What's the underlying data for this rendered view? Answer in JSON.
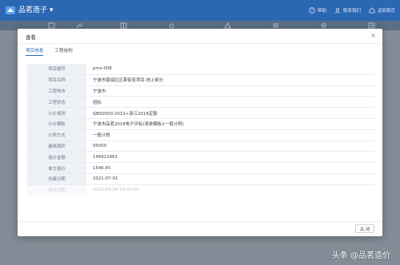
{
  "app": {
    "title": "品茗造子 ▾"
  },
  "top_actions": [
    {
      "label": "帮助",
      "icon": "help-icon"
    },
    {
      "label": "联系我们",
      "icon": "contact-icon"
    },
    {
      "label": "返回首页",
      "icon": "home-icon"
    }
  ],
  "modal": {
    "title": "查看",
    "tabs": [
      {
        "label": "项目信息",
        "active": true
      },
      {
        "label": "工程结构",
        "active": false
      }
    ],
    "rows": [
      {
        "key": "项目编号",
        "value": "pms-008"
      },
      {
        "key": "项目名称",
        "value": "宁波市镇海区区某街景项目-地上部分"
      },
      {
        "key": "工程地市",
        "value": "宁波市"
      },
      {
        "key": "工程状态",
        "value": "招标"
      },
      {
        "key": "计价规则",
        "value": "GB50500-2013+浙江2018定额"
      },
      {
        "key": "计价模板",
        "value": "宁波市品茗2018电子评标(清单模板)(一般计税)"
      },
      {
        "key": "计税方式",
        "value": "一般计税"
      },
      {
        "key": "建筑面积",
        "value": "95000"
      },
      {
        "key": "造价金额",
        "value": "146912461"
      },
      {
        "key": "单方造价",
        "value": "1546.45"
      },
      {
        "key": "创建日期",
        "value": "2021-07-01"
      },
      {
        "key": "修改日期",
        "value": "2022-03-04 14:33:00"
      }
    ],
    "close_button": "关 闭"
  },
  "watermark": "头条 @品茗造价",
  "colors": {
    "brand": "#2b67b3"
  }
}
